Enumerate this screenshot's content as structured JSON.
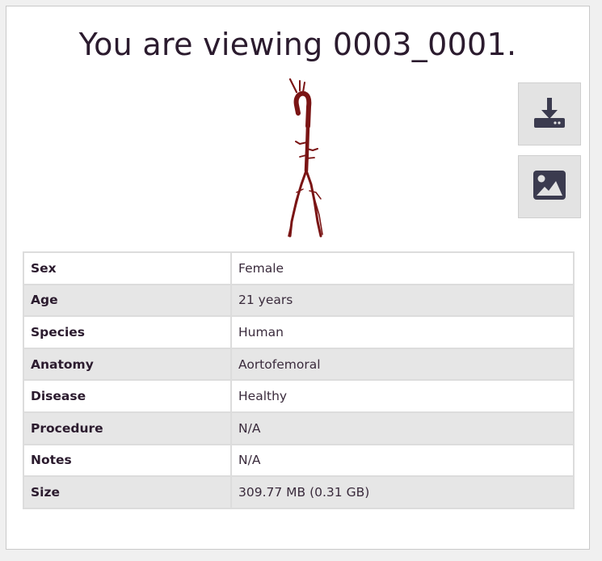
{
  "title": "You are viewing 0003_0001.",
  "actions": {
    "download_icon": "download-icon",
    "image_icon": "image-icon"
  },
  "colors": {
    "vessel": "#7a1414",
    "button_bg": "#e3e3e3",
    "icon": "#3b3b4f",
    "row_shade": "#e6e6e6"
  },
  "info": [
    {
      "label": "Sex",
      "value": "Female"
    },
    {
      "label": "Age",
      "value": "21 years"
    },
    {
      "label": "Species",
      "value": "Human"
    },
    {
      "label": "Anatomy",
      "value": "Aortofemoral"
    },
    {
      "label": "Disease",
      "value": "Healthy"
    },
    {
      "label": "Procedure",
      "value": "N/A"
    },
    {
      "label": "Notes",
      "value": "N/A"
    },
    {
      "label": "Size",
      "value": "309.77 MB (0.31 GB)"
    }
  ]
}
